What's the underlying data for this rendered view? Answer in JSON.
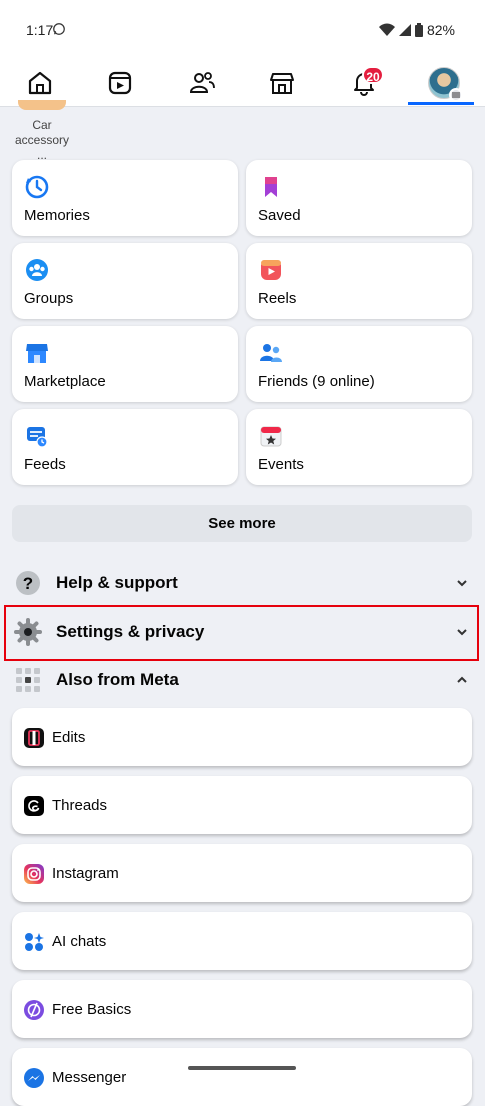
{
  "status_bar": {
    "time": "1:17",
    "battery": "82%"
  },
  "nav": {
    "notifications_badge": "20",
    "tabs": [
      "home-icon",
      "video-icon",
      "friends-icon",
      "marketplace-icon",
      "notifications-icon",
      "profile-menu-icon"
    ]
  },
  "shortcut": {
    "label": "Car accessory ..."
  },
  "grid": {
    "memories": "Memories",
    "saved": "Saved",
    "groups": "Groups",
    "reels": "Reels",
    "marketplace": "Marketplace",
    "friends": "Friends (9 online)",
    "feeds": "Feeds",
    "events": "Events"
  },
  "see_more": "See more",
  "sections": {
    "help": "Help & support",
    "settings": "Settings & privacy",
    "also_meta": "Also from Meta"
  },
  "meta_apps": {
    "edits": "Edits",
    "threads": "Threads",
    "instagram": "Instagram",
    "ai_chats": "AI chats",
    "free_basics": "Free Basics",
    "messenger": "Messenger"
  },
  "colors": {
    "accent": "#0866ff",
    "badge": "#e41e3f",
    "highlight": "#e6000c"
  }
}
